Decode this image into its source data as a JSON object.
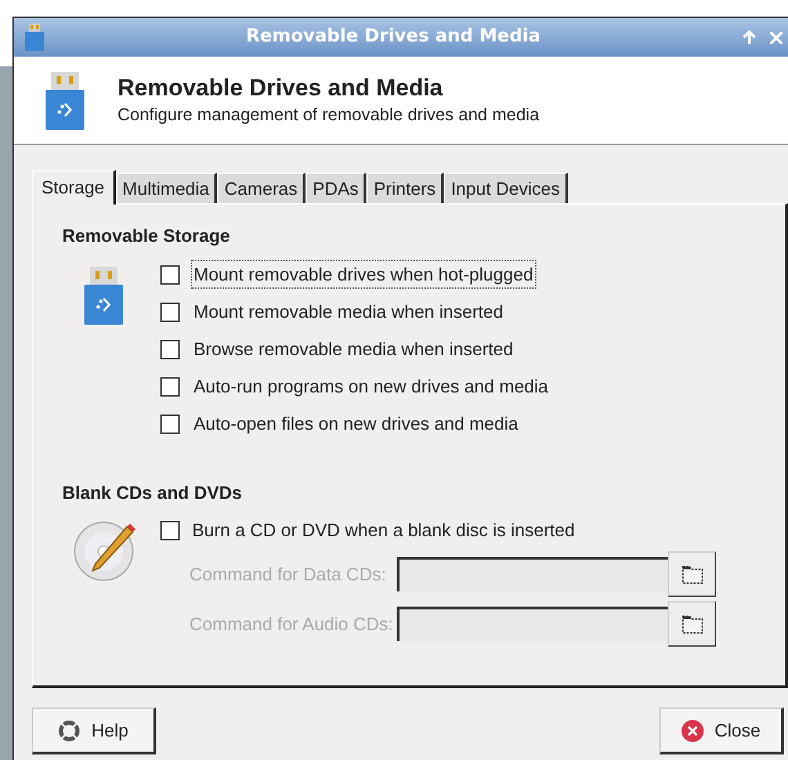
{
  "window": {
    "title": "Removable Drives and Media"
  },
  "header": {
    "title": "Removable Drives and Media",
    "subtitle": "Configure management of removable drives and media"
  },
  "tabs": [
    {
      "label": "Storage",
      "selected": true
    },
    {
      "label": "Multimedia",
      "selected": false
    },
    {
      "label": "Cameras",
      "selected": false
    },
    {
      "label": "PDAs",
      "selected": false
    },
    {
      "label": "Printers",
      "selected": false
    },
    {
      "label": "Input Devices",
      "selected": false
    }
  ],
  "removable_storage": {
    "heading": "Removable Storage",
    "options": [
      {
        "label": "Mount removable drives when hot-plugged",
        "checked": false,
        "focused": true
      },
      {
        "label": "Mount removable media when inserted",
        "checked": false,
        "focused": false
      },
      {
        "label": "Browse removable media when inserted",
        "checked": false,
        "focused": false
      },
      {
        "label": "Auto-run programs on new drives and media",
        "checked": false,
        "focused": false
      },
      {
        "label": "Auto-open files on new drives and media",
        "checked": false,
        "focused": false
      }
    ]
  },
  "blank_discs": {
    "heading": "Blank CDs and DVDs",
    "option": {
      "label": "Burn a CD or DVD when a blank disc is inserted",
      "checked": false
    },
    "commands": [
      {
        "label": "Command for Data CDs:",
        "disabled": true
      },
      {
        "label": "Command for Audio CDs:",
        "disabled": true
      }
    ]
  },
  "buttons": [
    {
      "label": "Help",
      "kind": "help"
    },
    {
      "label": "Close",
      "kind": "close"
    }
  ]
}
